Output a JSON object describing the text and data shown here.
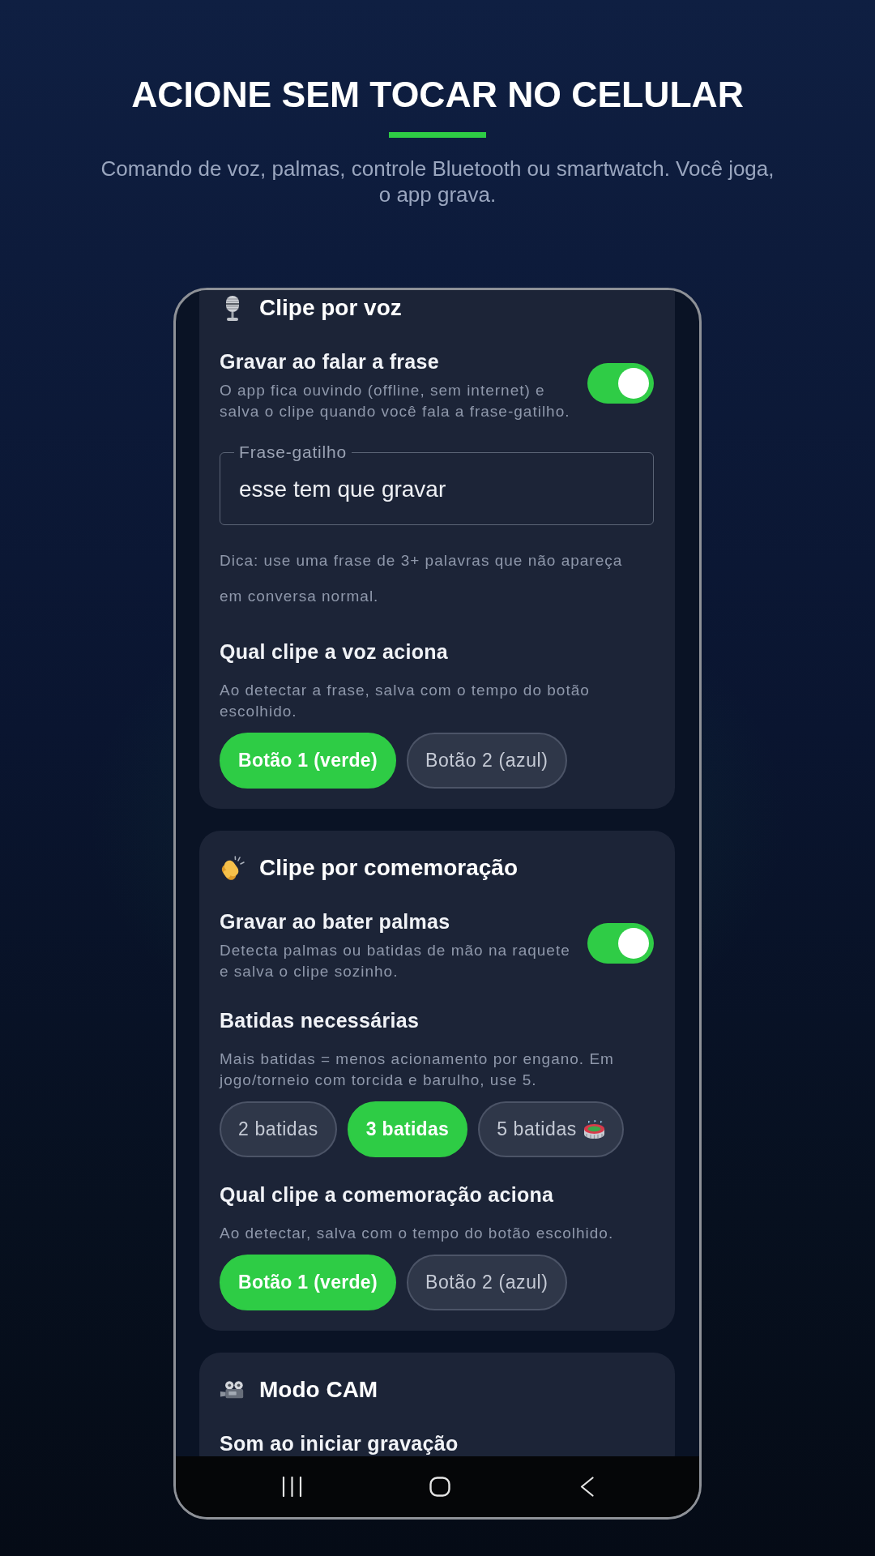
{
  "header": {
    "title": "ACIONE SEM TOCAR NO CELULAR",
    "subtitle": "Comando de voz, palmas, controle Bluetooth ou smartwatch. Você joga, o app grava."
  },
  "phone": {
    "cards": [
      {
        "title": "Clipe por voz",
        "items": [
          {
            "kind": "toggle",
            "label": "Gravar ao falar a frase",
            "description": "O app fica ouvindo (offline, sem internet) e salva o clipe quando você fala a frase-gatilho.",
            "on": true
          },
          {
            "kind": "field",
            "label": "Frase-gatilho",
            "value": "esse tem que gravar"
          },
          {
            "kind": "hint",
            "text": "Dica: use uma frase de 3+ palavras que não apareça em conversa normal."
          },
          {
            "kind": "choice",
            "label": "Qual clipe a voz aciona",
            "description": "Ao detectar a frase, salva com o tempo do botão escolhido.",
            "options": [
              {
                "kind": "text",
                "label": "Botão 1 (verde)",
                "selected": true
              },
              {
                "kind": "text",
                "label": "Botão 2 (azul)",
                "selected": false
              }
            ]
          }
        ]
      },
      {
        "title": "Clipe por comemoração",
        "items": [
          {
            "kind": "toggle",
            "label": "Gravar ao bater palmas",
            "description": "Detecta palmas ou batidas de mão na raquete e salva o clipe sozinho.",
            "on": true
          },
          {
            "kind": "choice",
            "label": "Batidas necessárias",
            "description": "Mais batidas = menos acionamento por engano. Em jogo/torneio com torcida e barulho, use 5.",
            "options": [
              {
                "kind": "text",
                "label": "2 batidas",
                "selected": false
              },
              {
                "kind": "text",
                "label": "3 batidas",
                "selected": true
              },
              {
                "kind": "icon",
                "label": "5 batidas",
                "selected": false
              }
            ]
          },
          {
            "kind": "choice",
            "label": "Qual clipe a comemoração aciona",
            "description": "Ao detectar, salva com o tempo do botão escolhido.",
            "options": [
              {
                "kind": "text",
                "label": "Botão 1 (verde)",
                "selected": true
              },
              {
                "kind": "text",
                "label": "Botão 2 (azul)",
                "selected": false
              }
            ]
          }
        ]
      },
      {
        "title": "Modo CAM",
        "items": [
          {
            "kind": "heading",
            "label": "Som ao iniciar gravação"
          }
        ]
      }
    ]
  }
}
